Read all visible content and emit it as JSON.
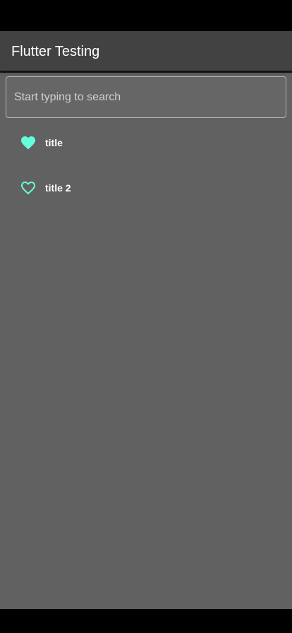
{
  "app": {
    "title": "Flutter Testing"
  },
  "search": {
    "placeholder": "Start typing to search",
    "value": ""
  },
  "list": {
    "items": [
      {
        "label": "title",
        "favorited": true,
        "icon": "heart-filled-icon"
      },
      {
        "label": "title 2",
        "favorited": false,
        "icon": "heart-outline-icon"
      }
    ]
  },
  "colors": {
    "app_bar": "#424242",
    "body_background": "#616161",
    "accent": "#64FFDA",
    "text": "#FFFFFF"
  }
}
